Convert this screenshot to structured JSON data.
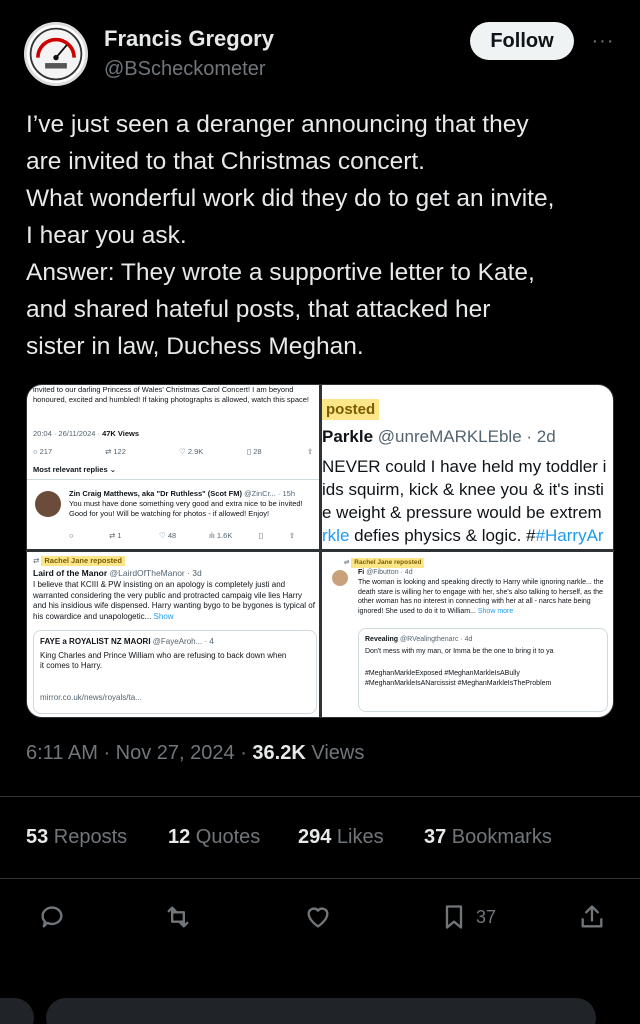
{
  "author": {
    "name": "Francis Gregory",
    "handle": "@BScheckometer",
    "avatar_icon": "gauge-meter-avatar"
  },
  "follow_label": "Follow",
  "more_label": "···",
  "tweet_lines": [
    "I’ve just seen a deranger announcing that they",
    "are invited to that Christmas concert.",
    "What wonderful work did they do to get an invite,",
    "I hear you ask.",
    "Answer: They wrote a supportive letter to Kate,",
    "and shared hateful posts, that attacked her",
    "sister in law, Duchess Meghan."
  ],
  "media": {
    "panel1": {
      "text": "invited to our darling Princess of Wales' Christmas Carol Concert! I am beyond honoured, excited and humbled! If taking photographs is allowed, watch this space!",
      "timestamp": "20:04 · 26/11/2024 ·",
      "views": "47K Views",
      "counts": [
        "217",
        "122",
        "2.9K",
        "28"
      ],
      "replies_label": "Most relevant replies ⌄",
      "reply_name": "Zin Craig Matthews, aka \"Dr Ruthless\" (Scot FM)",
      "reply_handle": "@ZinCr... · 15h",
      "reply_text": "You must have done something very good and extra nice to be invited! Good for you! Will be watching for photos - if allowed! Enjoy!",
      "reply_counts": [
        "1",
        "48",
        "1.6K"
      ]
    },
    "panel2": {
      "badge": "posted",
      "name": "Parkle",
      "handle": "@unreMARKLEble · 2d",
      "lines": [
        "NEVER could I have held my toddler i",
        "ids squirm, kick & knee you & it's insti",
        "e weight & pressure would be extrem"
      ],
      "last_prefix": "rkle",
      "last_mid": " defies physics & logic. #",
      "last_tag": "#HarryAr"
    },
    "panel3": {
      "repost": "Rachel Jane reposted",
      "name": "Laird of the Manor",
      "handle": "@LairdOfTheManor · 3d",
      "text": "I believe that KCIII & PW insisting on an apology is completely justi and warranted considering the very public and protracted campaig vile lies Harry and his insidious wife dispensed. Harry wanting bygo to be bygones is typical of his cowardice and unapologetic...",
      "show": "Show",
      "quote_name": "FAYE a ROYALIST NZ MAORI",
      "quote_handle": "@FayeAroh... · 4",
      "quote_text": "King Charles and Prince William who are refusing to back down when it comes to Harry.",
      "link": "mirror.co.uk/news/royals/ta..."
    },
    "panel4": {
      "repost": "Rachel Jane reposted",
      "name": "Fi",
      "handle": "@Fibutton · 4d",
      "text": "The woman is looking and speaking directly to Harry while ignoring narkle... the death stare is willing her to engage with her, she's also talking to herself, as the other woman has no interest in connecting with her at all - narcs hate being ignored! She used to do it to William...",
      "show_more": "Show more",
      "quote_name": "Revealing",
      "quote_handle": "@RVealingthenarc · 4d",
      "quote_text": "Don't mess with my man, or Imma be the one to bring it to ya",
      "hashtags": "#MeghanMarkleExposed #MeghanMarkleIsABully #MeghanMarkleIsANarcissist #MeghanMarkleIsTheProblem"
    }
  },
  "meta": {
    "time_date": "6:11 AM · Nov 27, 2024 · ",
    "views_count": "36.2K",
    "views_label": " Views"
  },
  "stats": {
    "reposts": {
      "count": "53",
      "label": " Reposts"
    },
    "quotes": {
      "count": "12",
      "label": " Quotes"
    },
    "likes": {
      "count": "294",
      "label": " Likes"
    },
    "bookmarks": {
      "count": "37",
      "label": " Bookmarks"
    }
  },
  "actions": {
    "reply_icon": "reply-icon",
    "repost_icon": "repost-icon",
    "like_icon": "heart-icon",
    "bookmark_icon": "bookmark-icon",
    "bookmark_count": "37",
    "share_icon": "share-icon"
  }
}
